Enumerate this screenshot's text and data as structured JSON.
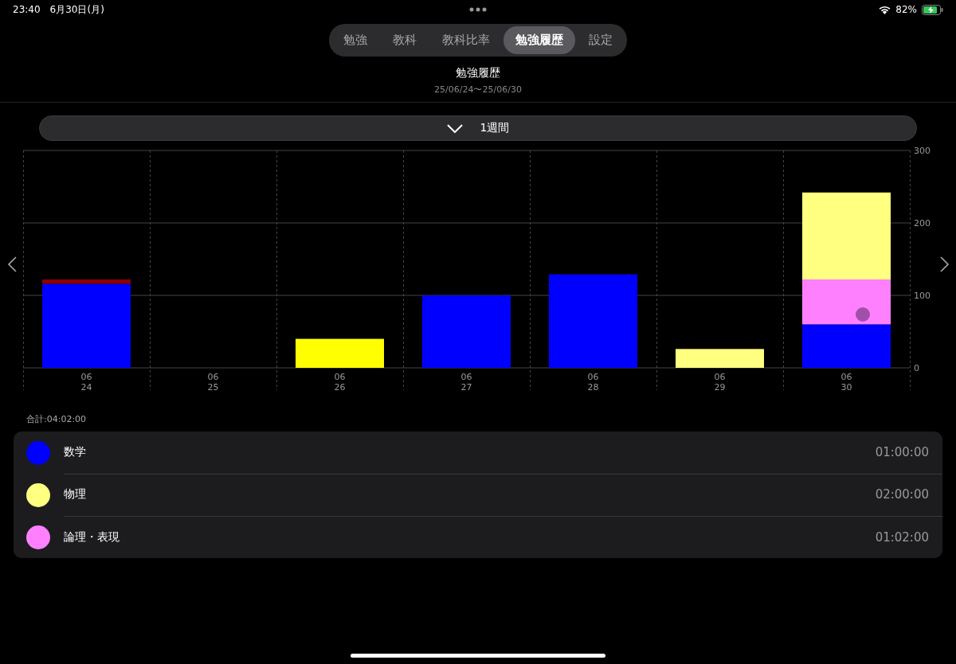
{
  "status_bar": {
    "time": "23:40",
    "date": "6月30日(月)",
    "battery": "82%"
  },
  "tabs": [
    {
      "label": "勉強",
      "selected": false
    },
    {
      "label": "教科",
      "selected": false
    },
    {
      "label": "教科比率",
      "selected": false
    },
    {
      "label": "勉強履歴",
      "selected": true
    },
    {
      "label": "設定",
      "selected": false
    }
  ],
  "header": {
    "title": "勉強履歴",
    "range": "25/06/24〜25/06/30"
  },
  "period_selector": {
    "label": "1週間"
  },
  "chart_data": {
    "type": "bar",
    "stacked": true,
    "categories": [
      "06\n24",
      "06\n25",
      "06\n26",
      "06\n27",
      "06\n28",
      "06\n29",
      "06\n30"
    ],
    "ylim": [
      0,
      300
    ],
    "yticks": [
      0,
      100,
      200,
      300
    ],
    "series": [
      {
        "color": "#0000ff",
        "values": [
          116,
          0,
          0,
          100,
          129,
          0,
          60
        ]
      },
      {
        "color": "#8b0000",
        "values": [
          6,
          0,
          0,
          0,
          0,
          0,
          0
        ]
      },
      {
        "color": "#ffff00",
        "values": [
          0,
          0,
          40,
          0,
          0,
          0,
          0
        ]
      },
      {
        "color": "#ff80ff",
        "values": [
          0,
          0,
          0,
          0,
          0,
          0,
          62
        ]
      },
      {
        "color": "#ffff80",
        "values": [
          0,
          0,
          0,
          0,
          0,
          26,
          120
        ]
      }
    ]
  },
  "total": "合計:04:02:00",
  "subjects": [
    {
      "name": "数学",
      "color": "#0000ff",
      "time": "01:00:00"
    },
    {
      "name": "物理",
      "color": "#ffff80",
      "time": "02:00:00"
    },
    {
      "name": "論理・表現",
      "color": "#ff80ff",
      "time": "01:02:00"
    }
  ]
}
